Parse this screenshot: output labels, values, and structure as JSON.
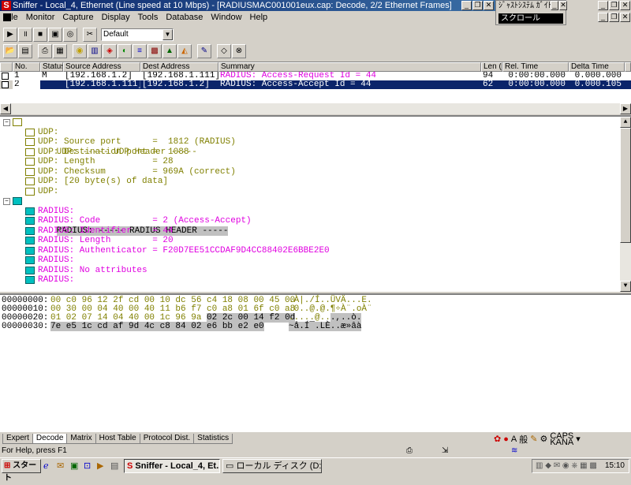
{
  "window": {
    "title": "Sniffer - Local_4, Ethernet (Line speed at 10 Mbps) - [RADIUSMAC001001eux.cap: Decode, 2/2 Ethernet Frames]"
  },
  "ime_window": {
    "title": "ｼﾞｬｽﾄｼｽﾃﾑ ｶﾞｲﾄﾞ",
    "bar_text": "スクロール"
  },
  "menu": [
    "File",
    "Monitor",
    "Capture",
    "Display",
    "Tools",
    "Database",
    "Window",
    "Help"
  ],
  "toolbar": {
    "profile": "Default"
  },
  "packet_table": {
    "columns": [
      "No.",
      "Status",
      "Source Address",
      "Dest Address",
      "Summary",
      "Len (B)",
      "Rel. Time",
      "Delta Time"
    ],
    "rows": [
      {
        "no": "1",
        "status": "M",
        "src": "[192.168.1.2]",
        "dst": "[192.168.1.111]",
        "summary": "RADIUS: Access-Request Id = 44",
        "len": "94",
        "rel": "0:00:00.000",
        "delta": "0.000.000"
      },
      {
        "no": "2",
        "status": "",
        "src": "[192.168.1.111]",
        "dst": "[192.168.1.2]",
        "summary": "RADIUS: Access-Accept Id = 44",
        "len": "62",
        "rel": "0:00:00.000",
        "delta": "0.000.105"
      }
    ]
  },
  "decode": {
    "udp_header": "UDP: ----- UDP Header -----",
    "udp_lines": [
      "UDP:",
      "UDP: Source port      =  1812 (RADIUS)",
      "UDP: Destination port =  1088",
      "UDP: Length           = 28",
      "UDP: Checksum         = 969A (correct)",
      "UDP: [20 byte(s) of data]",
      "UDP:"
    ],
    "radius_header": "RADIUS: ----- RADIUS HEADER -----",
    "radius_lines": [
      "RADIUS:",
      "RADIUS: Code          = 2 (Access-Accept)",
      "RADIUS: Identifier    = 44",
      "RADIUS: Length        = 20",
      "RADIUS: Authenticator = F20D7EE51CCDAF9D4CC88402E6BBE2E0",
      "RADIUS:",
      "RADIUS: No attributes",
      "RADIUS:"
    ]
  },
  "hex": [
    {
      "offset": "00000000:",
      "bytes_plain": "00 c0 96 12 2f cd 00 10 dc 56 c4 18 08 00 45 00",
      "bytes_hl": "",
      "ascii_plain": ".À|./Í..ÜVÄ...E.",
      "ascii_hl": ""
    },
    {
      "offset": "00000010:",
      "bytes_plain": "00 30 00 04 40 00 40 11 b6 f7 c0 a8 01 6f c0 a8",
      "bytes_hl": "",
      "ascii_plain": ".0..@.@.¶÷À¨.oÀ¨",
      "ascii_hl": ""
    },
    {
      "offset": "00000020:",
      "bytes_plain": "01 02 07 14 04 40 00 1c 96 9a ",
      "bytes_hl": "02 2c 00 14 f2 0d",
      "ascii_plain": ".....@..",
      "ascii_hl": ".,..ò."
    },
    {
      "offset": "00000030:",
      "bytes_plain": "",
      "bytes_hl": "7e e5 1c cd af 9d 4c c8 84 02 e6 bb e2 e0",
      "ascii_plain": "",
      "ascii_hl": "~å.Í¯.LÈ..æ»âà"
    }
  ],
  "tabs": [
    "Expert",
    "Decode",
    "Matrix",
    "Host Table",
    "Protocol Dist.",
    "Statistics"
  ],
  "active_tab": "Decode",
  "langbar": {
    "mode": "A",
    "kana": "般",
    "caps": "CAPS",
    "kana_label": "KANA"
  },
  "status": "For Help, press F1",
  "taskbar": {
    "start": "スタート",
    "buttons": [
      "Sniffer - Local_4, Et...",
      "ローカル ディスク (D:)"
    ],
    "clock": "15:10"
  },
  "colors": {
    "titlebar": "#0a246a",
    "selection": "#0a246a",
    "udp_text": "#808000",
    "radius_text": "#e000e0"
  }
}
